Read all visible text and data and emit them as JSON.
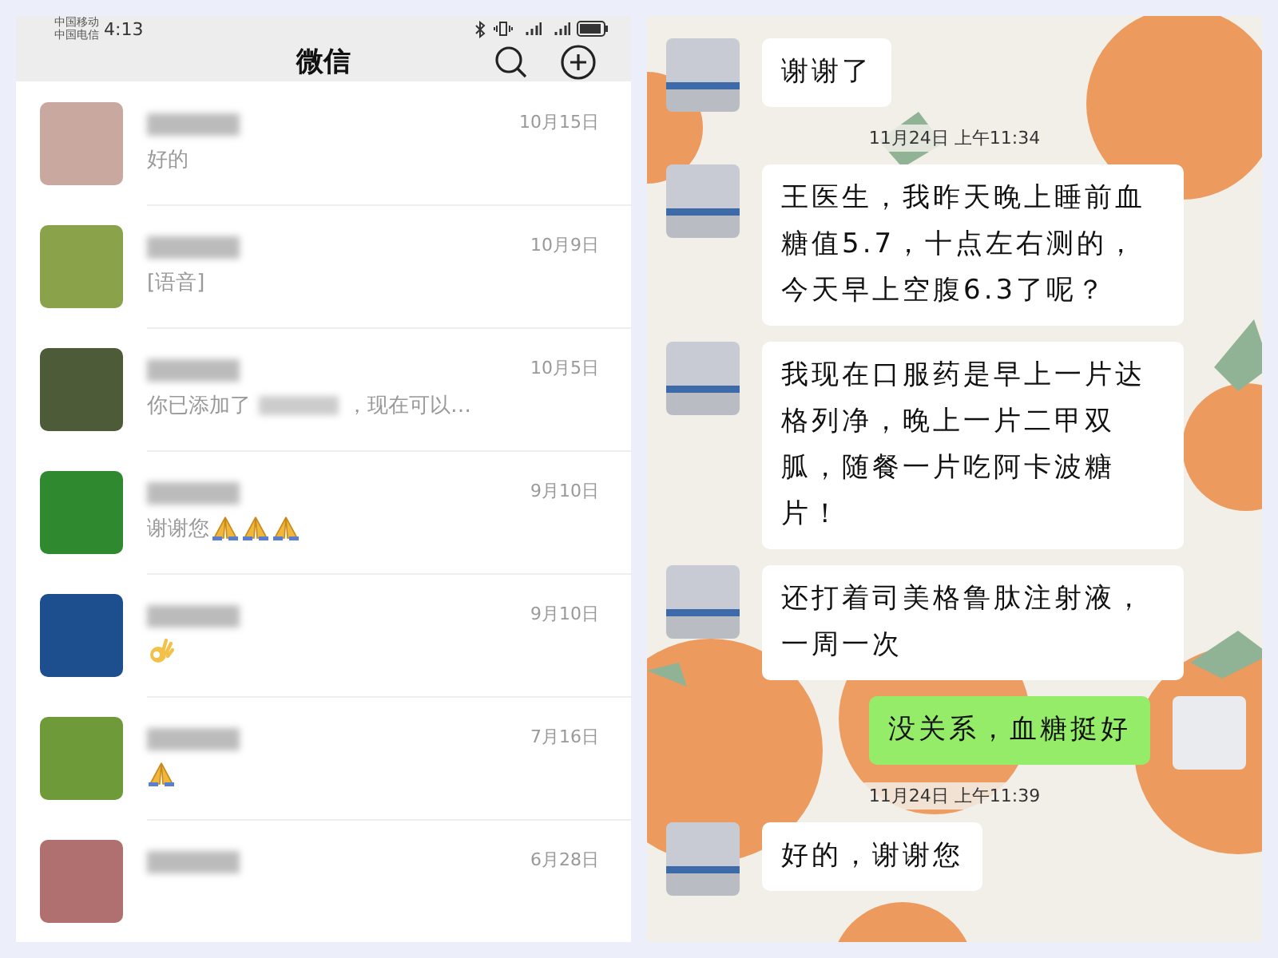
{
  "chat_list_screen": {
    "status_bar": {
      "carriers": [
        "中国移动",
        "中国电信"
      ],
      "time": "4:13"
    },
    "title": "微信",
    "conversations": [
      {
        "date": "10月15日",
        "preview": [
          {
            "kind": "text",
            "text": "好的"
          }
        ]
      },
      {
        "date": "10月9日",
        "preview": [
          {
            "kind": "text",
            "text": "[语音]"
          }
        ]
      },
      {
        "date": "10月5日",
        "preview": [
          {
            "kind": "text",
            "text": "你已添加了"
          },
          {
            "kind": "blur"
          },
          {
            "kind": "text",
            "text": "，现在可以…"
          }
        ]
      },
      {
        "date": "9月10日",
        "preview": [
          {
            "kind": "text",
            "text": "谢谢您"
          },
          {
            "kind": "pray"
          },
          {
            "kind": "pray"
          },
          {
            "kind": "pray"
          }
        ]
      },
      {
        "date": "9月10日",
        "preview": [
          {
            "kind": "ok"
          }
        ]
      },
      {
        "date": "7月16日",
        "preview": [
          {
            "kind": "pray"
          }
        ]
      },
      {
        "date": "6月28日"
      }
    ]
  },
  "chat_screen": {
    "messages": [
      {
        "kind": "received",
        "text": "谢谢了"
      },
      {
        "kind": "time",
        "text": "11月24日 上午11:34"
      },
      {
        "kind": "received",
        "text": "王医生，我昨天晚上睡前血糖值5.7，十点左右测的，今天早上空腹6.3了呢？"
      },
      {
        "kind": "received",
        "text": "我现在口服药是早上一片达格列净，晚上一片二甲双胍，随餐一片吃阿卡波糖片！"
      },
      {
        "kind": "received",
        "text": "还打着司美格鲁肽注射液，一周一次"
      },
      {
        "kind": "sent",
        "text": "没关系，血糖挺好"
      },
      {
        "kind": "time",
        "text": "11月24日 上午11:39"
      },
      {
        "kind": "received",
        "text": "好的，谢谢您"
      }
    ]
  }
}
